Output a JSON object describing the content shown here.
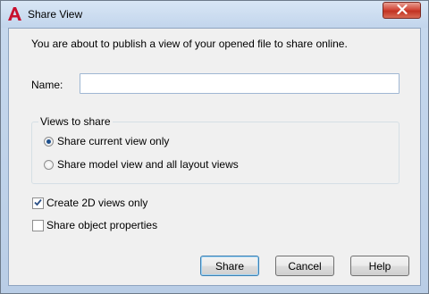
{
  "window": {
    "title": "Share View",
    "close_icon": "close-icon",
    "app_icon": "autocad-a-icon"
  },
  "dialog": {
    "intro_text": "You are about to publish a view of your opened file to share online.",
    "name_label": "Name:",
    "name_value": "",
    "views_group": {
      "legend": "Views to share",
      "options": [
        {
          "label": "Share current view only",
          "selected": true
        },
        {
          "label": "Share model view and all layout views",
          "selected": false
        }
      ]
    },
    "checkboxes": [
      {
        "label": "Create 2D views only",
        "checked": true
      },
      {
        "label": "Share object properties",
        "checked": false
      }
    ],
    "buttons": {
      "share": "Share",
      "cancel": "Cancel",
      "help": "Help"
    }
  },
  "colors": {
    "close_button": "#c23322",
    "app_icon_red": "#c8102e",
    "radio_dot": "#1d4f8c"
  }
}
